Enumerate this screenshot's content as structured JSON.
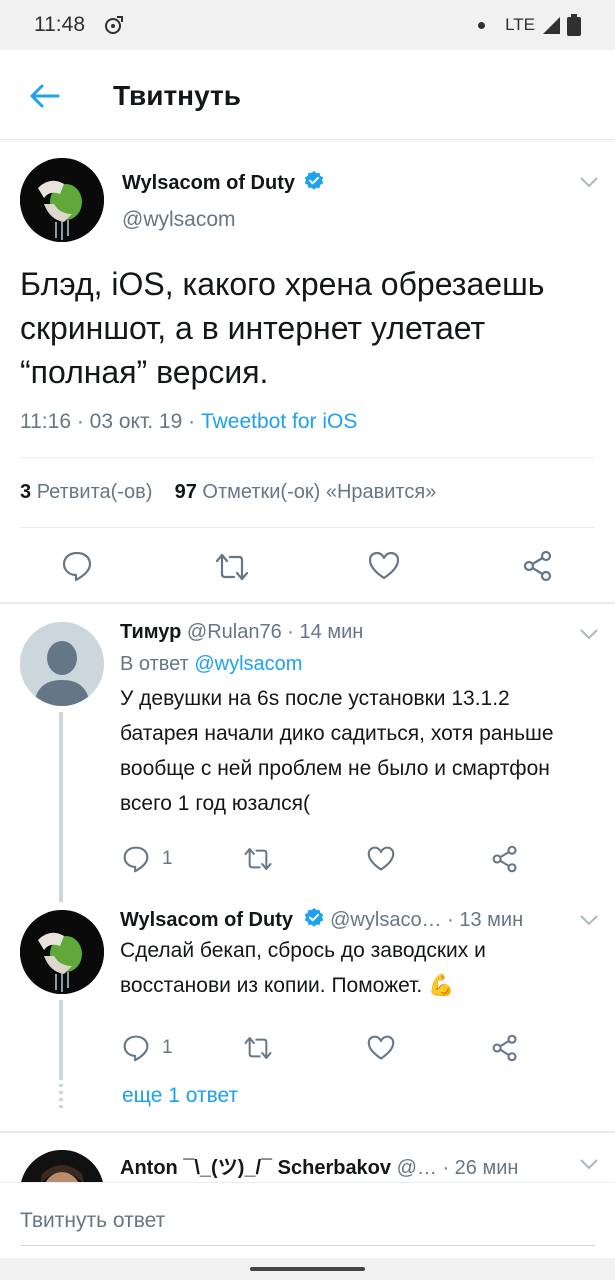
{
  "status": {
    "time": "11:48",
    "network": "LTE"
  },
  "header": {
    "title": "Твитнуть"
  },
  "main_tweet": {
    "name": "Wylsacom of Duty",
    "handle": "@wylsacom",
    "text": "Блэд, iOS, какого хрена обрезаешь скриншот, а в интернет улетает “полная” версия.",
    "time": "11:16 · 03 окт. 19 · ",
    "source": "Tweetbot for iOS",
    "retweets_count": "3",
    "retweets_label": "Ретвита(-ов)",
    "likes_count": "97",
    "likes_label": "Отметки(-ок) «Нравится»"
  },
  "reply1": {
    "name": "Тимур",
    "handle": "@Rulan76",
    "time": "· 14 мин",
    "reply_prefix": "В ответ",
    "reply_to": "@wylsacom",
    "text": "У девушки на 6s после установки 13.1.2 батарея начали дико садиться, хотя раньше вообще с ней проблем не было и смартфон всего 1 год юзался(",
    "reply_count": "1"
  },
  "reply2": {
    "name": "Wylsacom of Duty",
    "handle": "@wylsaco…",
    "time": "· 13 мин",
    "text": "Сделай бекап, сбрось до заводских и восстанови из копии. Поможет. 💪",
    "reply_count": "1"
  },
  "more_replies": "еще 1 ответ",
  "reply3": {
    "name": "Anton ¯\\_(ツ)_/¯ Scherbakov",
    "handle": "@…",
    "time": "· 26 мин"
  },
  "compose": {
    "placeholder": "Твитнуть ответ"
  },
  "colors": {
    "accent": "#1da1f2",
    "text": "#14171a",
    "muted": "#657786",
    "border": "#e6ecf0"
  },
  "icons": [
    "back-arrow-icon",
    "verified-icon",
    "chevron-down-icon",
    "reply-icon",
    "retweet-icon",
    "like-icon",
    "share-icon"
  ]
}
